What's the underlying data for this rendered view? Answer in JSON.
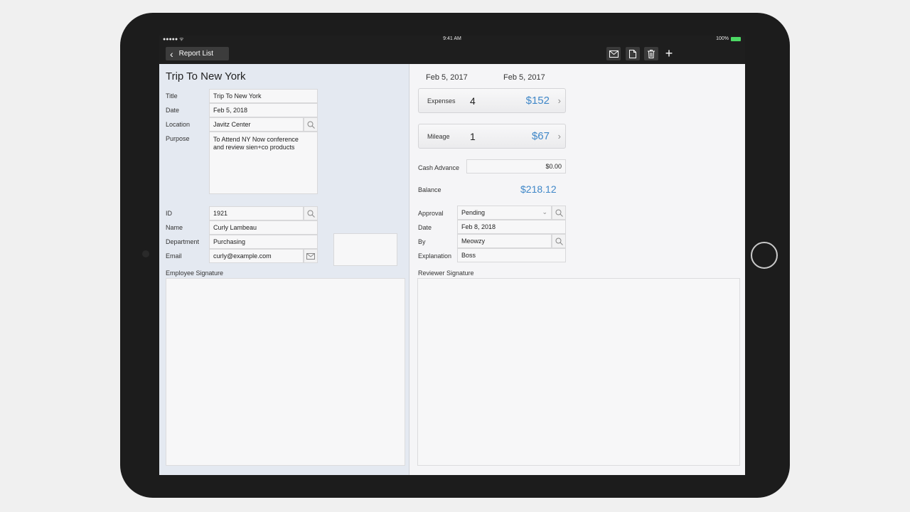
{
  "status": {
    "signal": "●●●●● ᯤ",
    "time": "9:41 AM",
    "battery": "100%"
  },
  "nav": {
    "back_label": "Report List"
  },
  "trip": {
    "title": "Trip To New York"
  },
  "form": {
    "title_label": "Title",
    "title_value": "Trip To New York",
    "date_label": "Date",
    "date_value": "Feb 5, 2018",
    "location_label": "Location",
    "location_value": "Javitz Center",
    "purpose_label": "Purpose",
    "purpose_value": "To Attend NY Now conference\nand review sien+co products"
  },
  "employee": {
    "id_label": "ID",
    "id_value": "1921",
    "name_label": "Name",
    "name_value": "Curly Lambeau",
    "dept_label": "Department",
    "dept_value": "Purchasing",
    "email_label": "Email",
    "email_value": "curly@example.com",
    "signature_label": "Employee Signature"
  },
  "summary": {
    "start_date": "Feb 5, 2017",
    "end_date": "Feb 5, 2017",
    "expenses": {
      "label": "Expenses",
      "count": "4",
      "amount": "$152"
    },
    "mileage": {
      "label": "Mileage",
      "count": "1",
      "amount": "$67"
    },
    "cash_advance_label": "Cash Advance",
    "cash_advance_value": "$0.00",
    "balance_label": "Balance",
    "balance_value": "$218.12"
  },
  "approval": {
    "approval_label": "Approval",
    "approval_value": "Pending",
    "date_label": "Date",
    "date_value": "Feb 8, 2018",
    "by_label": "By",
    "by_value": "Meowzy",
    "explanation_label": "Explanation",
    "explanation_value": "Boss",
    "signature_label": "Reviewer Signature"
  },
  "icons": {
    "search": "search-icon",
    "mail": "envelope-icon",
    "document": "document-icon",
    "trash": "trash-icon",
    "plus": "plus-icon",
    "back": "chevron-left-icon"
  },
  "colors": {
    "accent": "#3f87c8",
    "navbar": "#1e1e1e",
    "left_panel": "#e4e9f1"
  }
}
